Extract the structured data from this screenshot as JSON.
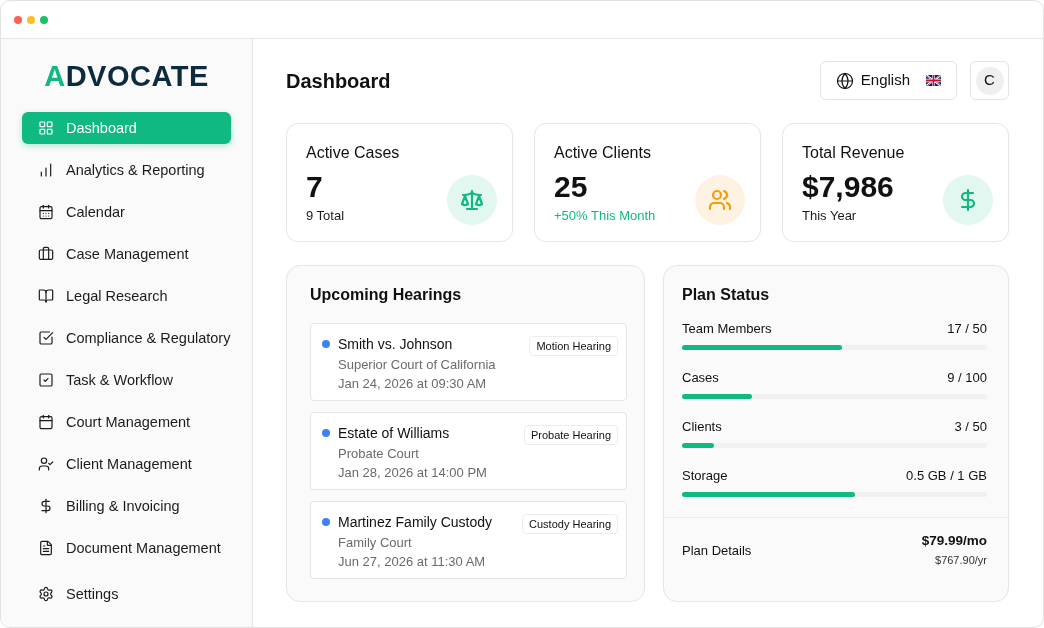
{
  "sidebar": {
    "logo": "ADVOCATE",
    "items": [
      {
        "label": "Dashboard",
        "selected": true
      },
      {
        "label": "Analytics & Reporting",
        "selected": false
      },
      {
        "label": "Calendar",
        "selected": false
      },
      {
        "label": "Case Management",
        "selected": false
      },
      {
        "label": "Legal Research",
        "selected": false
      },
      {
        "label": "Compliance & Regulatory",
        "selected": false
      },
      {
        "label": "Task & Workflow",
        "selected": false
      },
      {
        "label": "Court Management",
        "selected": false
      },
      {
        "label": "Client Management",
        "selected": false
      },
      {
        "label": "Billing & Invoicing",
        "selected": false
      },
      {
        "label": "Document Management",
        "selected": false
      }
    ],
    "bottom_items": [
      {
        "label": "Settings",
        "selected": false
      }
    ]
  },
  "header": {
    "title": "Dashboard",
    "language": {
      "label": "English"
    },
    "avatar": {
      "initial": "C"
    }
  },
  "stats": [
    {
      "title": "Active Cases",
      "value": "7",
      "note": "9 Total",
      "note_positive": false,
      "color": "#10b981"
    },
    {
      "title": "Active Clients",
      "value": "25",
      "note": "+50% This Month",
      "note_positive": true,
      "color": "#f59e0b"
    },
    {
      "title": "Total Revenue",
      "value": "$7,986",
      "note": "This Year",
      "note_positive": false,
      "color": "#10b981"
    }
  ],
  "hearings": {
    "title": "Upcoming Hearings",
    "items": [
      {
        "name": "Smith vs. Johnson",
        "court": "Superior Court of California",
        "date": "Jan 24, 2026 at 09:30 AM",
        "type": "Motion Hearing",
        "color": "#3b82f6"
      },
      {
        "name": "Estate of Williams",
        "court": "Probate Court",
        "date": "Jan 28, 2026 at 14:00 PM",
        "type": "Probate Hearing",
        "color": "#3b82f6"
      },
      {
        "name": "Martinez Family Custody",
        "court": "Family Court",
        "date": "Jun 27, 2026 at 11:30 AM",
        "type": "Custody Hearing",
        "color": "#3b82f6"
      }
    ]
  },
  "plan": {
    "title": "Plan Status",
    "usage": [
      {
        "label": "Team Members",
        "reading": "17 / 50",
        "level": 0.525
      },
      {
        "label": "Cases",
        "reading": "9 / 100",
        "level": 0.23
      },
      {
        "label": "Clients",
        "reading": "3 / 50",
        "level": 0.105
      },
      {
        "label": "Storage",
        "reading": "0.5 GB / 1 GB",
        "level": 0.567
      }
    ],
    "details": {
      "label": "Plan Details",
      "monthly": "$79.99/mo",
      "yearly": "$767.90/yr"
    }
  }
}
